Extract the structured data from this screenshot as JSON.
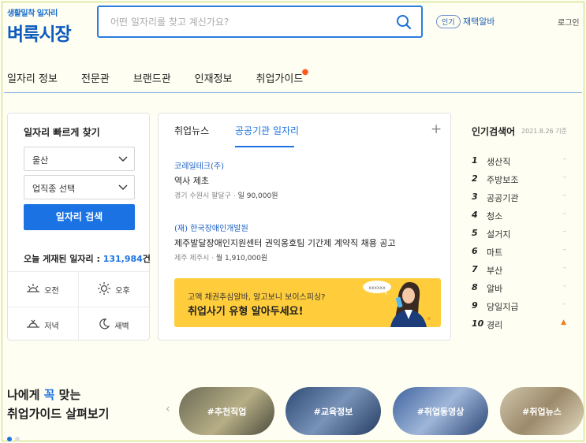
{
  "header": {
    "logo_sub": "생활밀착 일자리",
    "logo_main": "벼룩시장",
    "search_placeholder": "어떤 일자리를 찾고 계신가요?",
    "hot_tag": "인기",
    "hot_word": "재택알바",
    "login": "로그인"
  },
  "nav": {
    "items": [
      "일자리 정보",
      "전문관",
      "브랜드관",
      "인재정보",
      "취업가이드"
    ]
  },
  "quick_find": {
    "title": "일자리 빠르게 찾기",
    "region": "울산",
    "industry": "업직종 선택",
    "search_button": "일자리 검색",
    "count_label": "오늘 게재된 일자리 : ",
    "count_value": "131,984",
    "count_unit": "건",
    "time_filters": [
      "오전",
      "오후",
      "저녁",
      "새벽"
    ]
  },
  "news": {
    "tabs": [
      "취업뉴스",
      "공공기관 일자리"
    ],
    "plus": "+",
    "jobs": [
      {
        "company": "코레일테크(주)",
        "title": "역사 제초",
        "location": "경기 수원시 팔달구",
        "pay_type": "일",
        "pay": "90,000원"
      },
      {
        "company": "(재) 한국장애인개발원",
        "title": "제주발달장애인지원센터 권익옹호팀 기간제 계약직 채용 공고",
        "location": "제주 제주시",
        "pay_type": "월",
        "pay": "1,910,000원"
      }
    ],
    "banner_line1": "고액 채권추심알바, 알고보니 보이스피싱?",
    "banner_line2": "취업사기 유형 알아두세요!",
    "banner_bubble": "xxxxxx"
  },
  "ranking": {
    "title": "인기검색어",
    "date": "2021.8.26 기준",
    "items": [
      {
        "n": "1",
        "word": "생산직",
        "status": "–"
      },
      {
        "n": "2",
        "word": "주방보조",
        "status": "–"
      },
      {
        "n": "3",
        "word": "공공기관",
        "status": "–"
      },
      {
        "n": "4",
        "word": "청소",
        "status": "–"
      },
      {
        "n": "5",
        "word": "설거지",
        "status": "–"
      },
      {
        "n": "6",
        "word": "마트",
        "status": "–"
      },
      {
        "n": "7",
        "word": "부산",
        "status": "–"
      },
      {
        "n": "8",
        "word": "알바",
        "status": "–"
      },
      {
        "n": "9",
        "word": "당일지급",
        "status": "–"
      },
      {
        "n": "10",
        "word": "경리",
        "status": "▲"
      }
    ]
  },
  "guide": {
    "line1_a": "나에게 ",
    "line1_hl": "꼭",
    "line1_b": " 맞는",
    "line2": "취업가이드 살펴보기",
    "cards": [
      "#추천직업",
      "#교육정보",
      "#취업동영상",
      "#취업뉴스"
    ]
  }
}
